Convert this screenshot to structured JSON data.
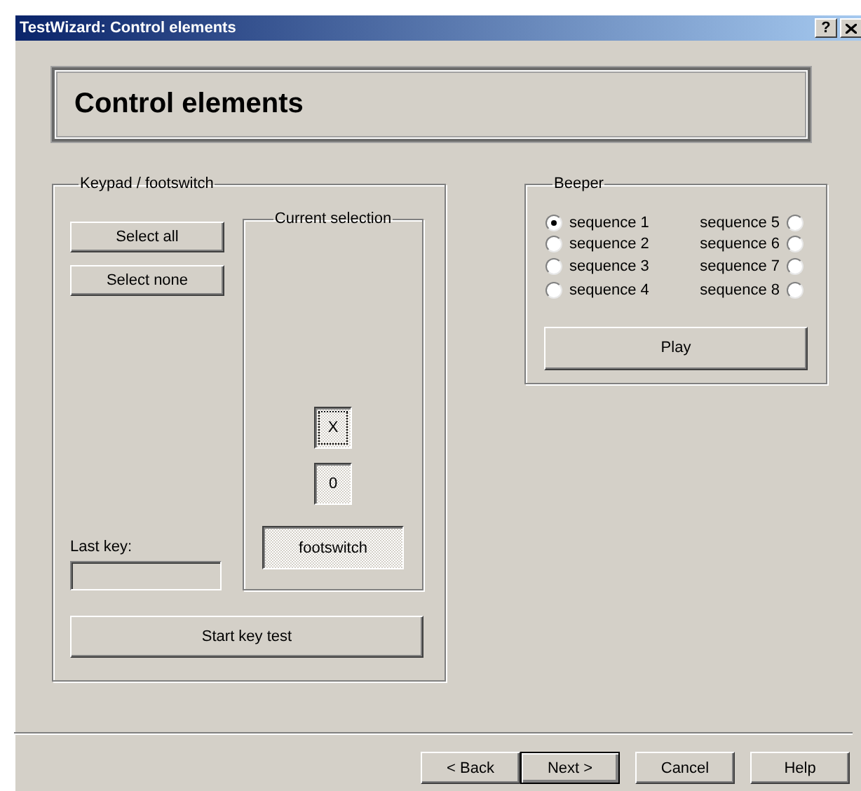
{
  "window": {
    "title": "TestWizard: Control elements",
    "help_button": "?"
  },
  "header": {
    "title": "Control elements"
  },
  "keypad": {
    "label": "Keypad / footswitch",
    "buttons": [
      {
        "label": "Select all"
      },
      {
        "label": "Select none"
      }
    ],
    "last_key": {
      "label": "Last key:"
    },
    "current_selection": {
      "label": "Current selection",
      "keys": [
        {
          "label": "X",
          "checked": true,
          "focused": true
        },
        {
          "label": "0",
          "checked": true,
          "focused": false
        }
      ],
      "footswitch": {
        "label": "footswitch",
        "checked": true
      }
    },
    "start_button": {
      "label": "Start key test"
    }
  },
  "beeper": {
    "label": "Beeper",
    "options": [
      {
        "label": "sequence 1",
        "kind": "label-right",
        "selected": true
      },
      {
        "label": "sequence 5",
        "kind": "label-left",
        "selected": false
      },
      {
        "label": "sequence 2",
        "kind": "label-right",
        "selected": false
      },
      {
        "label": "sequence 6",
        "kind": "label-left",
        "selected": false
      },
      {
        "label": "sequence 3",
        "kind": "label-right",
        "selected": false
      },
      {
        "label": "sequence 7",
        "kind": "label-left",
        "selected": false
      },
      {
        "label": "sequence 4",
        "kind": "label-right",
        "selected": false
      },
      {
        "label": "sequence 8",
        "kind": "label-left",
        "selected": false
      }
    ],
    "play_button": {
      "label": "Play"
    }
  },
  "footer_buttons": [
    {
      "label": "< Back",
      "default": false
    },
    {
      "label": "Next >",
      "default": true
    },
    {
      "label": "Cancel",
      "default": false
    },
    {
      "label": "Help",
      "default": false
    }
  ]
}
